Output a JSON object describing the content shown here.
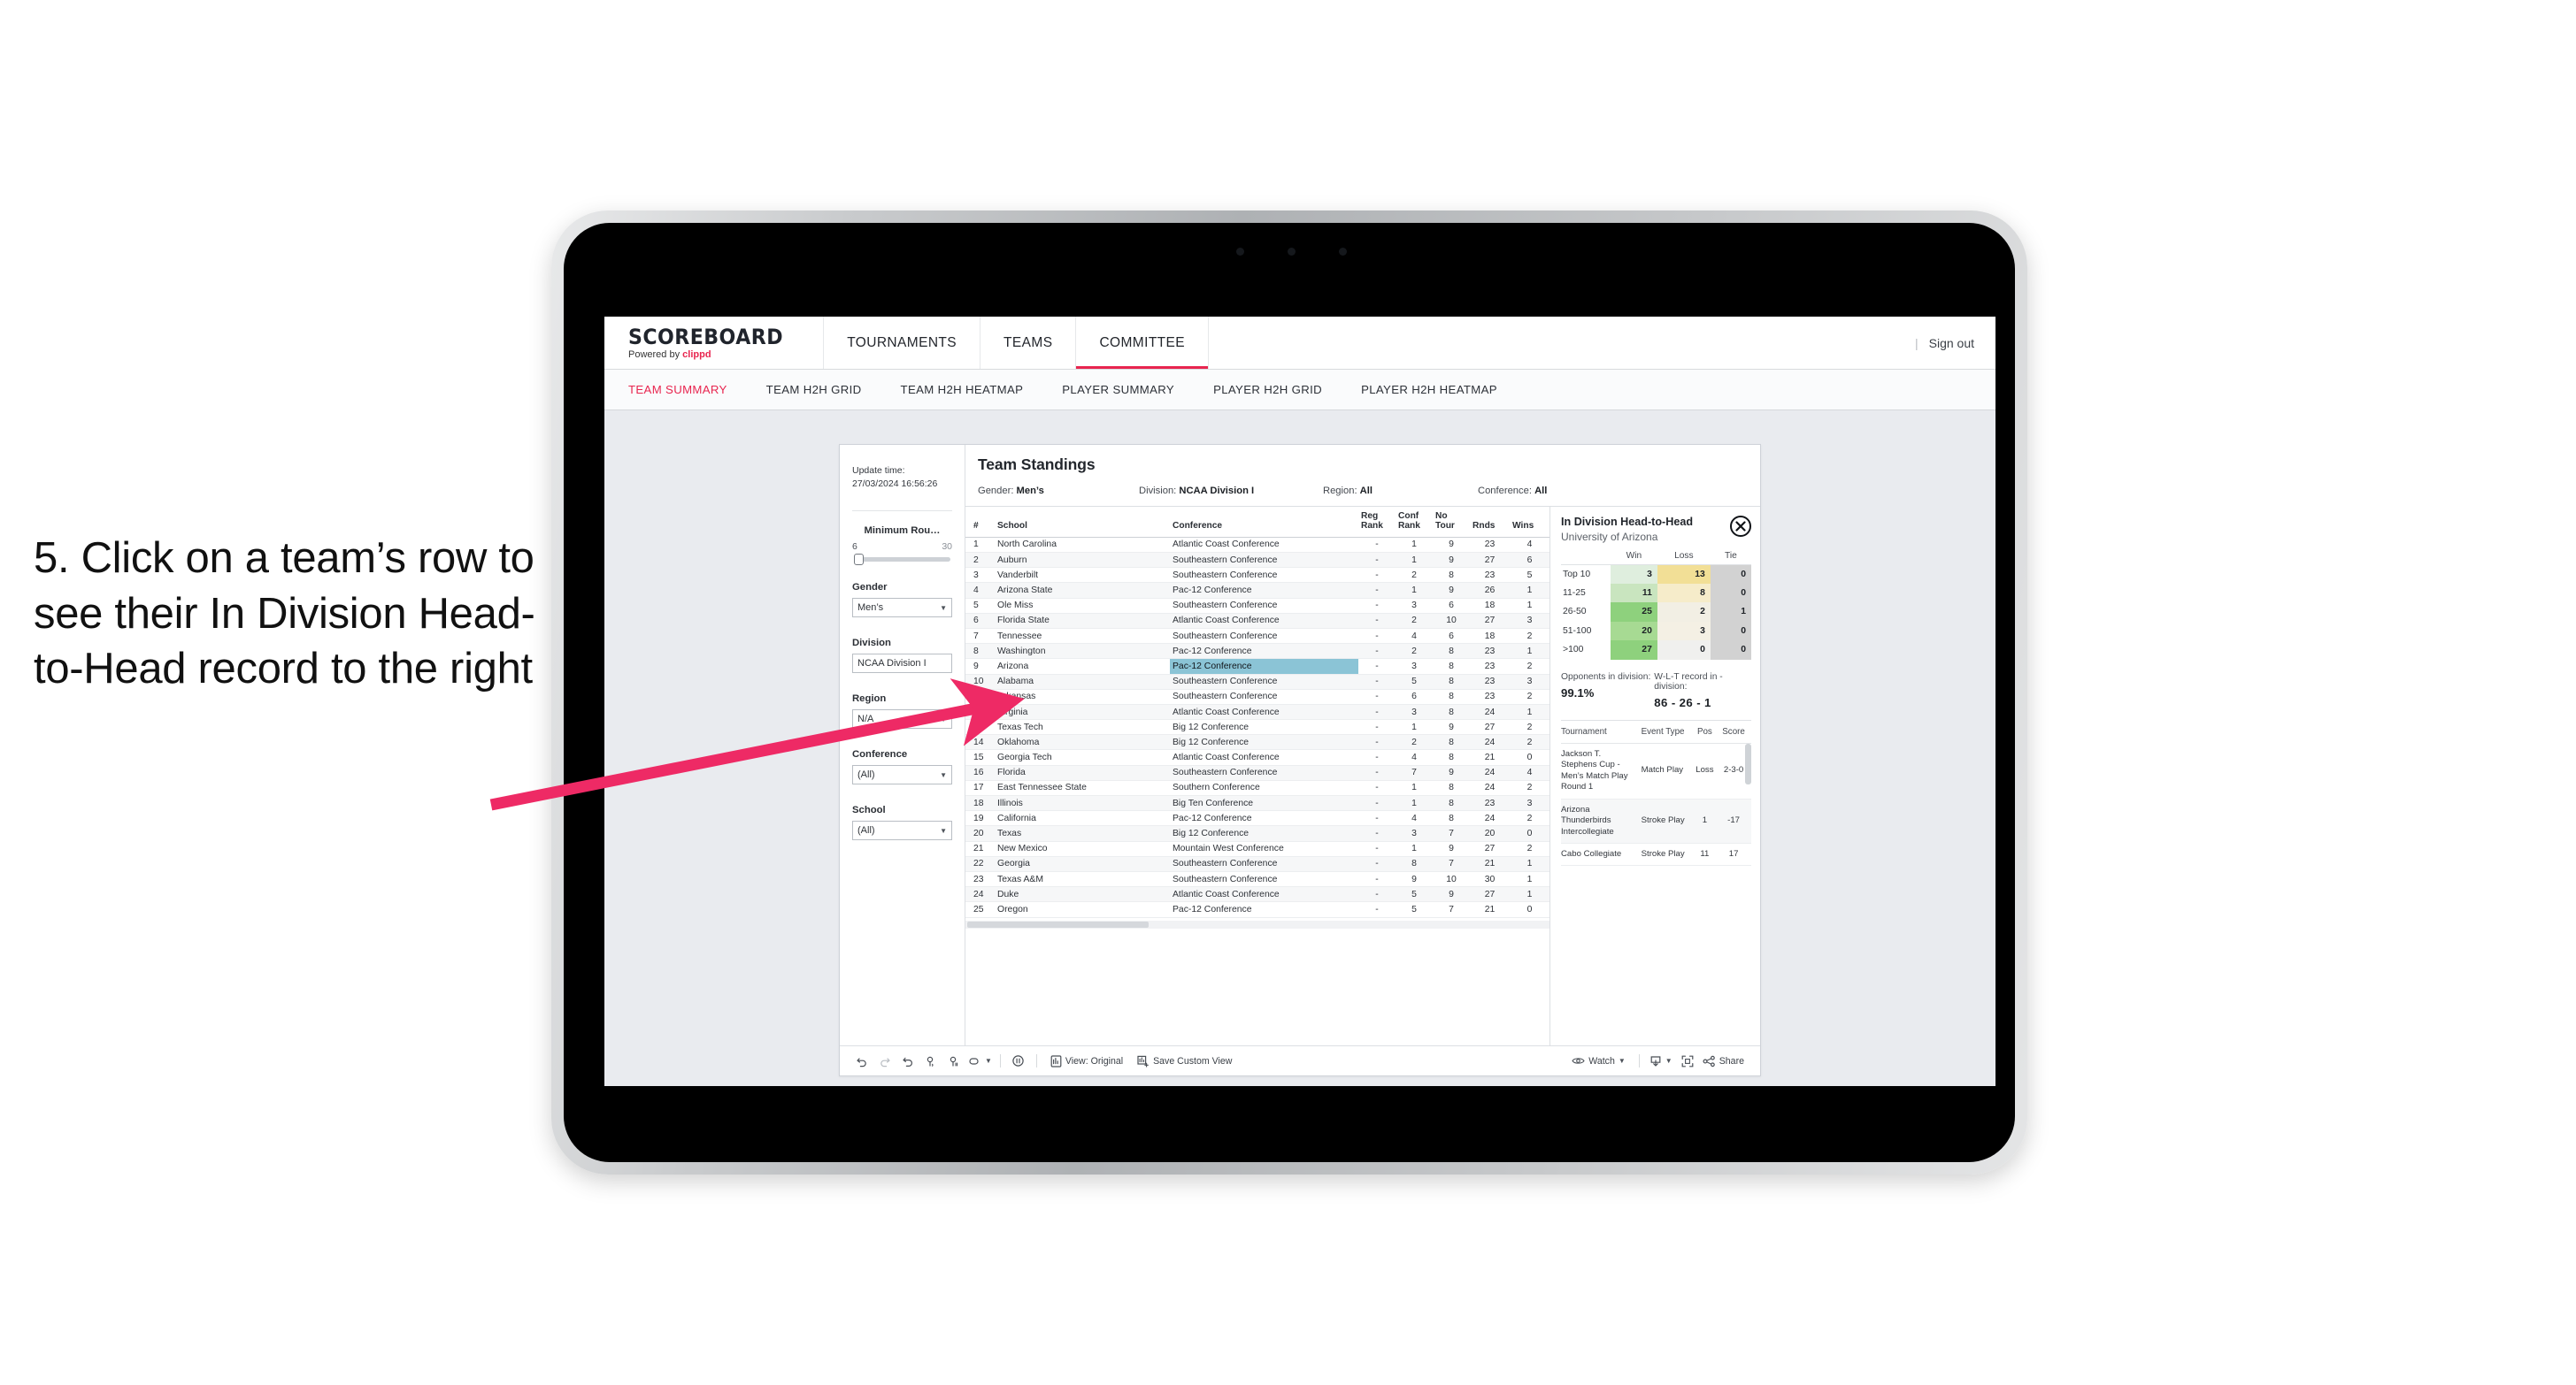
{
  "caption": {
    "text": "5. Click on a team’s row to see their In Division Head-to-Head record to the right"
  },
  "app": {
    "logo_main": "SCOREBOARD",
    "logo_sub_prefix": "Powered by ",
    "logo_sub_brand": "clippd",
    "nav": [
      {
        "label": "TOURNAMENTS",
        "active": false
      },
      {
        "label": "TEAMS",
        "active": false
      },
      {
        "label": "COMMITTEE",
        "active": true
      }
    ],
    "divider": "|",
    "sign_out": "Sign out",
    "subnav": [
      {
        "label": "TEAM SUMMARY",
        "active": true
      },
      {
        "label": "TEAM H2H GRID",
        "active": false
      },
      {
        "label": "TEAM H2H HEATMAP",
        "active": false
      },
      {
        "label": "PLAYER SUMMARY",
        "active": false
      },
      {
        "label": "PLAYER H2H GRID",
        "active": false
      },
      {
        "label": "PLAYER H2H HEATMAP",
        "active": false
      }
    ],
    "accent_color": "#e8254f"
  },
  "filters": {
    "update_time_label": "Update time:",
    "update_time_value": "27/03/2024 16:56:26",
    "slider": {
      "label": "Minimum Rou…",
      "min": "6",
      "max": "30"
    },
    "gender": {
      "label": "Gender",
      "value": "Men’s"
    },
    "division": {
      "label": "Division",
      "value": "NCAA Division I"
    },
    "region": {
      "label": "Region",
      "value": "N/A"
    },
    "conference": {
      "label": "Conference",
      "value": "(All)"
    },
    "school": {
      "label": "School",
      "value": "(All)"
    }
  },
  "standings": {
    "title": "Team Standings",
    "context": [
      {
        "key": "Gender: ",
        "val": "Men’s"
      },
      {
        "key": "Division: ",
        "val": "NCAA Division I"
      },
      {
        "key": "Region: ",
        "val": "All"
      },
      {
        "key": "Conference: ",
        "val": "All"
      }
    ],
    "columns": [
      "#",
      "School",
      "Conference",
      "Reg Rank",
      "Conf Rank",
      "No Tour",
      "Rnds",
      "Wins"
    ],
    "rows": [
      {
        "rank": "1",
        "school": "North Carolina",
        "conf": "Atlantic Coast Conference",
        "reg": "-",
        "confrank": "1",
        "notour": "9",
        "rnds": "23",
        "wins": "4",
        "sel": false
      },
      {
        "rank": "2",
        "school": "Auburn",
        "conf": "Southeastern Conference",
        "reg": "-",
        "confrank": "1",
        "notour": "9",
        "rnds": "27",
        "wins": "6",
        "sel": false
      },
      {
        "rank": "3",
        "school": "Vanderbilt",
        "conf": "Southeastern Conference",
        "reg": "-",
        "confrank": "2",
        "notour": "8",
        "rnds": "23",
        "wins": "5",
        "sel": false
      },
      {
        "rank": "4",
        "school": "Arizona State",
        "conf": "Pac-12 Conference",
        "reg": "-",
        "confrank": "1",
        "notour": "9",
        "rnds": "26",
        "wins": "1",
        "sel": false
      },
      {
        "rank": "5",
        "school": "Ole Miss",
        "conf": "Southeastern Conference",
        "reg": "-",
        "confrank": "3",
        "notour": "6",
        "rnds": "18",
        "wins": "1",
        "sel": false
      },
      {
        "rank": "6",
        "school": "Florida State",
        "conf": "Atlantic Coast Conference",
        "reg": "-",
        "confrank": "2",
        "notour": "10",
        "rnds": "27",
        "wins": "3",
        "sel": false
      },
      {
        "rank": "7",
        "school": "Tennessee",
        "conf": "Southeastern Conference",
        "reg": "-",
        "confrank": "4",
        "notour": "6",
        "rnds": "18",
        "wins": "2",
        "sel": false
      },
      {
        "rank": "8",
        "school": "Washington",
        "conf": "Pac-12 Conference",
        "reg": "-",
        "confrank": "2",
        "notour": "8",
        "rnds": "23",
        "wins": "1",
        "sel": false
      },
      {
        "rank": "9",
        "school": "Arizona",
        "conf": "Pac-12 Conference",
        "reg": "-",
        "confrank": "3",
        "notour": "8",
        "rnds": "23",
        "wins": "2",
        "sel": true
      },
      {
        "rank": "10",
        "school": "Alabama",
        "conf": "Southeastern Conference",
        "reg": "-",
        "confrank": "5",
        "notour": "8",
        "rnds": "23",
        "wins": "3",
        "sel": false
      },
      {
        "rank": "11",
        "school": "Arkansas",
        "conf": "Southeastern Conference",
        "reg": "-",
        "confrank": "6",
        "notour": "8",
        "rnds": "23",
        "wins": "2",
        "sel": false
      },
      {
        "rank": "12",
        "school": "Virginia",
        "conf": "Atlantic Coast Conference",
        "reg": "-",
        "confrank": "3",
        "notour": "8",
        "rnds": "24",
        "wins": "1",
        "sel": false
      },
      {
        "rank": "13",
        "school": "Texas Tech",
        "conf": "Big 12 Conference",
        "reg": "-",
        "confrank": "1",
        "notour": "9",
        "rnds": "27",
        "wins": "2",
        "sel": false
      },
      {
        "rank": "14",
        "school": "Oklahoma",
        "conf": "Big 12 Conference",
        "reg": "-",
        "confrank": "2",
        "notour": "8",
        "rnds": "24",
        "wins": "2",
        "sel": false
      },
      {
        "rank": "15",
        "school": "Georgia Tech",
        "conf": "Atlantic Coast Conference",
        "reg": "-",
        "confrank": "4",
        "notour": "8",
        "rnds": "21",
        "wins": "0",
        "sel": false
      },
      {
        "rank": "16",
        "school": "Florida",
        "conf": "Southeastern Conference",
        "reg": "-",
        "confrank": "7",
        "notour": "9",
        "rnds": "24",
        "wins": "4",
        "sel": false
      },
      {
        "rank": "17",
        "school": "East Tennessee State",
        "conf": "Southern Conference",
        "reg": "-",
        "confrank": "1",
        "notour": "8",
        "rnds": "24",
        "wins": "2",
        "sel": false
      },
      {
        "rank": "18",
        "school": "Illinois",
        "conf": "Big Ten Conference",
        "reg": "-",
        "confrank": "1",
        "notour": "8",
        "rnds": "23",
        "wins": "3",
        "sel": false
      },
      {
        "rank": "19",
        "school": "California",
        "conf": "Pac-12 Conference",
        "reg": "-",
        "confrank": "4",
        "notour": "8",
        "rnds": "24",
        "wins": "2",
        "sel": false
      },
      {
        "rank": "20",
        "school": "Texas",
        "conf": "Big 12 Conference",
        "reg": "-",
        "confrank": "3",
        "notour": "7",
        "rnds": "20",
        "wins": "0",
        "sel": false
      },
      {
        "rank": "21",
        "school": "New Mexico",
        "conf": "Mountain West Conference",
        "reg": "-",
        "confrank": "1",
        "notour": "9",
        "rnds": "27",
        "wins": "2",
        "sel": false
      },
      {
        "rank": "22",
        "school": "Georgia",
        "conf": "Southeastern Conference",
        "reg": "-",
        "confrank": "8",
        "notour": "7",
        "rnds": "21",
        "wins": "1",
        "sel": false
      },
      {
        "rank": "23",
        "school": "Texas A&M",
        "conf": "Southeastern Conference",
        "reg": "-",
        "confrank": "9",
        "notour": "10",
        "rnds": "30",
        "wins": "1",
        "sel": false
      },
      {
        "rank": "24",
        "school": "Duke",
        "conf": "Atlantic Coast Conference",
        "reg": "-",
        "confrank": "5",
        "notour": "9",
        "rnds": "27",
        "wins": "1",
        "sel": false
      },
      {
        "rank": "25",
        "school": "Oregon",
        "conf": "Pac-12 Conference",
        "reg": "-",
        "confrank": "5",
        "notour": "7",
        "rnds": "21",
        "wins": "0",
        "sel": false
      }
    ]
  },
  "h2h": {
    "title": "In Division Head-to-Head",
    "subtitle": "University of Arizona",
    "close_label": "×",
    "columns": [
      "",
      "Win",
      "Loss",
      "Tie"
    ],
    "rows": [
      {
        "band": "Top 10",
        "win": "3",
        "loss": "13",
        "tie": "0",
        "win_color": "#dfeede",
        "loss_color": "#f2df96",
        "tie_color": "#d2d2d2"
      },
      {
        "band": "11-25",
        "win": "11",
        "loss": "8",
        "tie": "0",
        "win_color": "#c9e5bf",
        "loss_color": "#f6ecca",
        "tie_color": "#d2d2d2"
      },
      {
        "band": "26-50",
        "win": "25",
        "loss": "2",
        "tie": "1",
        "win_color": "#8ed17d",
        "loss_color": "#f2efe4",
        "tie_color": "#d2d2d2"
      },
      {
        "band": "51-100",
        "win": "20",
        "loss": "3",
        "tie": "0",
        "win_color": "#a7da93",
        "loss_color": "#f4f0e4",
        "tie_color": "#d2d2d2"
      },
      {
        "band": ">100",
        "win": "27",
        "loss": "0",
        "tie": "0",
        "win_color": "#8ed17d",
        "loss_color": "#f0f0ee",
        "tie_color": "#d2d2d2"
      }
    ],
    "stats": [
      {
        "key": "Opponents in division:",
        "value": "99.1%"
      },
      {
        "key": "W-L-T record in -division:",
        "value": "86 - 26 - 1"
      }
    ],
    "tour_columns": [
      "Tournament",
      "Event Type",
      "Pos",
      "Score"
    ],
    "tour_rows": [
      {
        "tournament": "Jackson T. Stephens Cup - Men’s Match Play Round 1",
        "event": "Match Play",
        "pos": "Loss",
        "score": "2-3-0"
      },
      {
        "tournament": "Arizona Thunderbirds Intercollegiate",
        "event": "Stroke Play",
        "pos": "1",
        "score": "-17"
      },
      {
        "tournament": "Cabo Collegiate",
        "event": "Stroke Play",
        "pos": "11",
        "score": "17"
      }
    ]
  },
  "toolbar": {
    "view_label": "View: Original",
    "save_label": "Save Custom View",
    "watch_label": "Watch",
    "share_label": "Share"
  }
}
